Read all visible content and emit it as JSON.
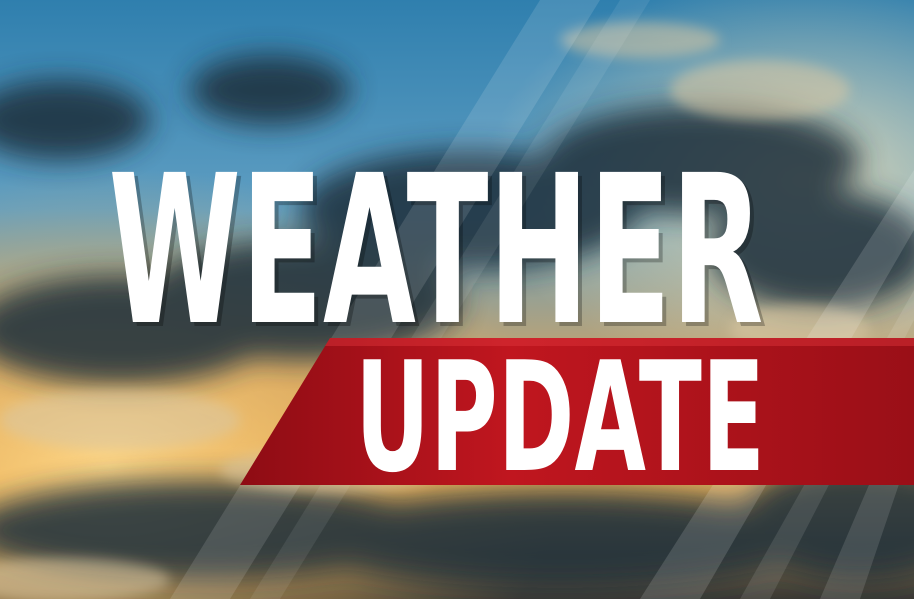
{
  "banner": {
    "headline": "WEATHER",
    "subheadline": "UPDATE"
  },
  "colors": {
    "headline_text": "#ffffff",
    "ribbon": "#b0141c",
    "ribbon_dark": "#7a0a10",
    "sky_top": "#3a8fc0",
    "sky_mid": "#6aa7c9",
    "sunset": "#e8b25a",
    "cloud_dark": "#1e2f3d"
  },
  "icons": [
    "cloud-shape",
    "light-stripe"
  ]
}
